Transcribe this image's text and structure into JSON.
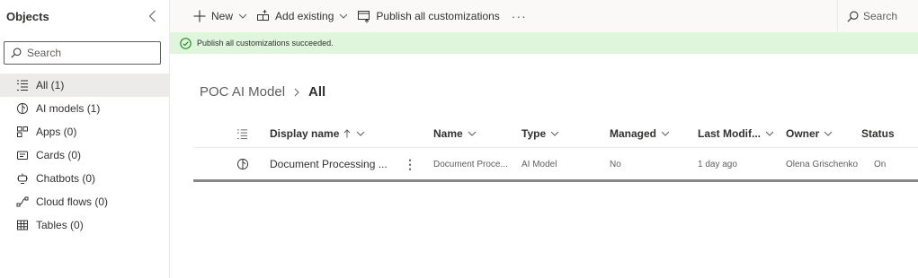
{
  "sidebar": {
    "title": "Objects",
    "search_placeholder": "Search",
    "items": [
      {
        "label": "All (1)",
        "icon": "list-icon",
        "active": true
      },
      {
        "label": "AI models (1)",
        "icon": "brain-icon"
      },
      {
        "label": "Apps (0)",
        "icon": "apps-grid-icon"
      },
      {
        "label": "Cards (0)",
        "icon": "card-icon"
      },
      {
        "label": "Chatbots (0)",
        "icon": "chatbot-icon"
      },
      {
        "label": "Cloud flows (0)",
        "icon": "flow-icon"
      },
      {
        "label": "Tables (0)",
        "icon": "table-icon"
      }
    ]
  },
  "toolbar": {
    "new_label": "New",
    "add_existing_label": "Add existing",
    "publish_label": "Publish all customizations",
    "more_label": "···",
    "search_label": "Search"
  },
  "banner": {
    "message": "Publish all customizations succeeded."
  },
  "breadcrumb": {
    "parent": "POC AI Model",
    "current": "All"
  },
  "grid": {
    "columns": {
      "display_name": "Display name",
      "name": "Name",
      "type": "Type",
      "managed": "Managed",
      "last_modified": "Last Modif...",
      "owner": "Owner",
      "status": "Status"
    },
    "rows": [
      {
        "display_name": "Document Processing ...",
        "more": "⋮",
        "name": "Document Proce...",
        "type": "AI Model",
        "managed": "No",
        "last_modified": "1 day ago",
        "owner": "Olena Grischenko",
        "status": "On"
      }
    ]
  },
  "colors": {
    "banner_bg": "#dff6dd",
    "success_green": "#107c10",
    "accent_blue": "#0078d4"
  }
}
